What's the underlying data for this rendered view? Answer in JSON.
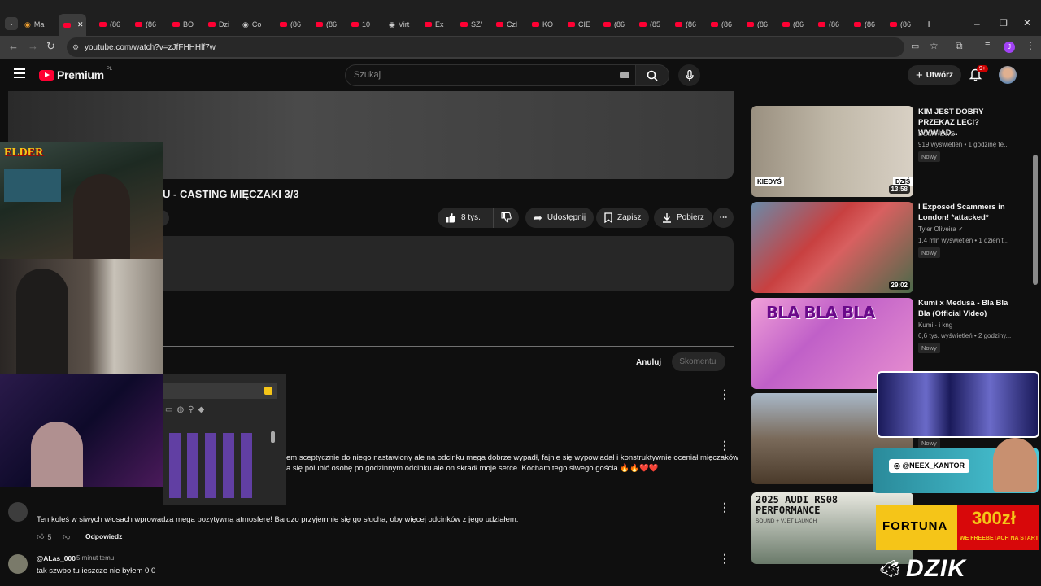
{
  "browser": {
    "tabs": [
      {
        "label": "Ma",
        "kind": "special"
      },
      {
        "label": "",
        "kind": "yt",
        "active": true
      },
      {
        "label": "(86",
        "kind": "yt"
      },
      {
        "label": "(86",
        "kind": "yt"
      },
      {
        "label": "BO",
        "kind": "yt"
      },
      {
        "label": "Dzi",
        "kind": "yt"
      },
      {
        "label": "Co",
        "kind": "other"
      },
      {
        "label": "(86",
        "kind": "yt"
      },
      {
        "label": "(86",
        "kind": "yt"
      },
      {
        "label": "10",
        "kind": "yt"
      },
      {
        "label": "Virt",
        "kind": "other"
      },
      {
        "label": "Ex",
        "kind": "yt"
      },
      {
        "label": "SZ/",
        "kind": "yt"
      },
      {
        "label": "Czł",
        "kind": "yt"
      },
      {
        "label": "KO",
        "kind": "yt"
      },
      {
        "label": "CIE",
        "kind": "yt"
      },
      {
        "label": "(86",
        "kind": "yt"
      },
      {
        "label": "(85",
        "kind": "yt"
      },
      {
        "label": "(86",
        "kind": "yt"
      },
      {
        "label": "(86",
        "kind": "yt"
      },
      {
        "label": "(86",
        "kind": "yt"
      },
      {
        "label": "(86",
        "kind": "yt"
      },
      {
        "label": "(86",
        "kind": "yt"
      },
      {
        "label": "(86",
        "kind": "yt"
      },
      {
        "label": "(86",
        "kind": "yt"
      }
    ],
    "new_tab": "+",
    "url": "youtube.com/watch?v=zJfFHHHlf7w",
    "profile_initial": "J"
  },
  "youtube": {
    "logo_text": "Premium",
    "logo_badge": "PL",
    "search_placeholder": "Szukaj",
    "create_label": "Utwórz",
    "notif_count": "9+"
  },
  "video": {
    "title": "U - CASTING MIĘCZAKI 3/3",
    "likes": "8 tys.",
    "share": "Udostępnij",
    "save": "Zapisz",
    "download": "Pobierz"
  },
  "comment_box": {
    "cancel": "Anuluj",
    "submit": "Skomentuj"
  },
  "comments": [
    {
      "text": "em sceptycznie do niego nastawiony ale na odcinku mega dobrze wypadł, fajnie się wypowiadał i konstruktywnie oceniał mięczaków",
      "text2": "a się polubić osobę po godzinnym odcinku ale on skradł moje serce. Kocham tego siwego gościa 🔥🔥❤️❤️"
    },
    {
      "text": "Ten koleś w siwych włosach wprowadza mega pozytywną atmosferę! Bardzo przyjemnie się go słucha, oby więcej odcinków z jego udziałem.",
      "likes": "5",
      "reply": "Odpowiedz"
    },
    {
      "author": "@ALas_000",
      "time": "5 minut temu",
      "text": "tak szwbo tu ieszcze nie byłem 0  0"
    }
  ],
  "sidebar": [
    {
      "title": "KIM JEST DOBRY PRZEKAZ LECI? WYWIAD...",
      "channel": "DOMINEWS",
      "meta": "919 wyświetleń • 1 godzinę te...",
      "badge": "Nowy",
      "duration": "13:58",
      "overlay_left": "KIEDYŚ",
      "overlay_right": "DZIŚ"
    },
    {
      "title": "I Exposed Scammers in London! *attacked*",
      "channel": "Tyler Oliveira",
      "meta": "1,4 mln wyświetleń • 1 dzień t...",
      "badge": "Nowy",
      "duration": "29:02"
    },
    {
      "title": "Kumi x Medusa - Bla Bla Bla (Official Video)",
      "channel": "Kumi · i kng",
      "meta": "6,6 tys. wyświetleń • 2 godziny...",
      "badge": "Nowy",
      "thumb_text": "BLA BLA BLA"
    },
    {
      "badge": "Nowy"
    },
    {
      "thumb_text": "2025 AUDI RS08 PERFORMANCE",
      "thumb_sub": "SOUND + VJET LAUNCH"
    }
  ],
  "overlays": {
    "stream_tag": "ELDER",
    "instagram": "@NEEX_KANTOR",
    "sponsor": "FORTUNA",
    "bonus": "300zł",
    "bonus_sub": "WE FREEBETACH NA START",
    "brand": "DZIK"
  }
}
